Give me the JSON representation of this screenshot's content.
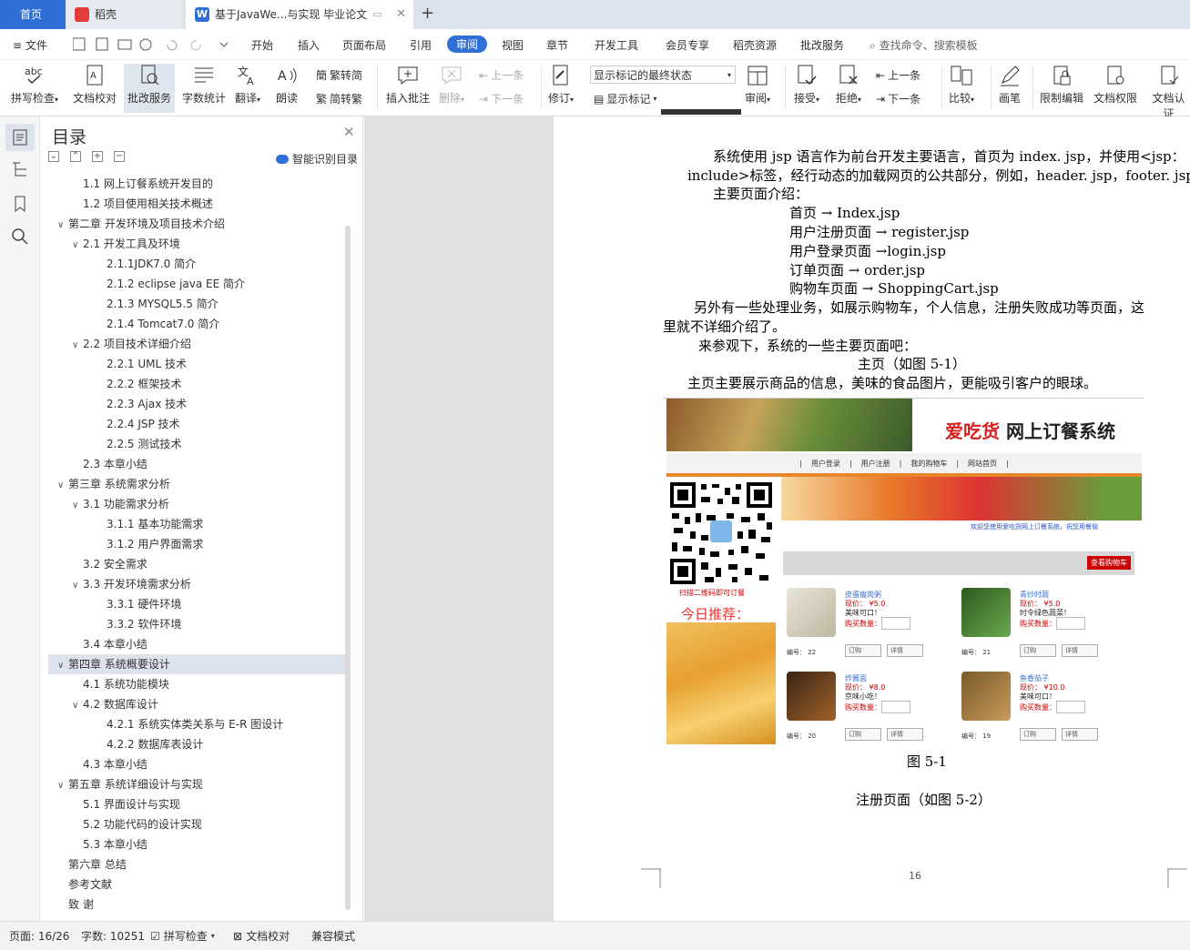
{
  "tabs": {
    "home": "首页",
    "daoke": "稻壳",
    "doc": "基于JavaWe...与实现 毕业论文"
  },
  "menu": {
    "file": "文件",
    "items": [
      "开始",
      "插入",
      "页面布局",
      "引用",
      "审阅",
      "视图",
      "章节",
      "开发工具",
      "会员专享",
      "稻壳资源",
      "批改服务"
    ],
    "active": "审阅",
    "search": "查找命令、搜索模板"
  },
  "toolbar": {
    "spell": "拼写检查",
    "proofread": "文档校对",
    "correct": "批改服务",
    "wordcount": "字数统计",
    "translate": "翻译",
    "read": "朗读",
    "to_trad": "繁转简",
    "to_simp": "简转繁",
    "insert_comment": "插入批注",
    "delete": "删除",
    "prev": "上一条",
    "next": "下一条",
    "track": "修订",
    "markup_state": "显示标记的最终状态",
    "show_markup": "显示标记",
    "review": "审阅",
    "accept": "接受",
    "reject": "拒绝",
    "prev2": "上一条",
    "next2": "下一条",
    "compare": "比较",
    "pen": "画笔",
    "restrict": "限制编辑",
    "perm": "文档权限",
    "cert": "文档认证"
  },
  "toc": {
    "title": "目录",
    "smart": "智能识别目录",
    "items": [
      {
        "label": "1.1  网上订餐系统开发目的",
        "lvl": 2,
        "car": ""
      },
      {
        "label": "1.2  项目使用相关技术概述",
        "lvl": 2,
        "car": ""
      },
      {
        "label": "第二章  开发环境及项目技术介绍",
        "lvl": 1,
        "car": "v"
      },
      {
        "label": "2.1  开发工具及环境",
        "lvl": 2,
        "car": "v"
      },
      {
        "label": "2.1.1JDK7.0 简介",
        "lvl": 3,
        "car": ""
      },
      {
        "label": "2.1.2 eclipse java EE 简介",
        "lvl": 3,
        "car": ""
      },
      {
        "label": "2.1.3 MYSQL5.5 简介",
        "lvl": 3,
        "car": ""
      },
      {
        "label": "2.1.4 Tomcat7.0 简介",
        "lvl": 3,
        "car": ""
      },
      {
        "label": "2.2  项目技术详细介绍",
        "lvl": 2,
        "car": "v"
      },
      {
        "label": "2.2.1 UML 技术",
        "lvl": 3,
        "car": ""
      },
      {
        "label": "2.2.2  框架技术",
        "lvl": 3,
        "car": ""
      },
      {
        "label": "2.2.3 Ajax 技术",
        "lvl": 3,
        "car": ""
      },
      {
        "label": "2.2.4 JSP 技术",
        "lvl": 3,
        "car": ""
      },
      {
        "label": "2.2.5  测试技术",
        "lvl": 3,
        "car": ""
      },
      {
        "label": "2.3  本章小结",
        "lvl": 2,
        "car": ""
      },
      {
        "label": "第三章  系统需求分析",
        "lvl": 1,
        "car": "v"
      },
      {
        "label": "3.1  功能需求分析",
        "lvl": 2,
        "car": "v"
      },
      {
        "label": "3.1.1  基本功能需求",
        "lvl": 3,
        "car": ""
      },
      {
        "label": "3.1.2  用户界面需求",
        "lvl": 3,
        "car": ""
      },
      {
        "label": "3.2  安全需求",
        "lvl": 2,
        "car": ""
      },
      {
        "label": "3.3 开发环境需求分析",
        "lvl": 2,
        "car": "v"
      },
      {
        "label": "3.3.1  硬件环境",
        "lvl": 3,
        "car": ""
      },
      {
        "label": "3.3.2  软件环境",
        "lvl": 3,
        "car": ""
      },
      {
        "label": "3.4  本章小结",
        "lvl": 2,
        "car": ""
      },
      {
        "label": "第四章  系统概要设计",
        "lvl": 1,
        "car": "v",
        "sel": true
      },
      {
        "label": "4.1  系统功能模块",
        "lvl": 2,
        "car": ""
      },
      {
        "label": "4.2  数据库设计",
        "lvl": 2,
        "car": "v"
      },
      {
        "label": "4.2.1  系统实体类关系与 E-R 图设计",
        "lvl": 3,
        "car": ""
      },
      {
        "label": "4.2.2  数据库表设计",
        "lvl": 3,
        "car": ""
      },
      {
        "label": "4.3  本章小结",
        "lvl": 2,
        "car": ""
      },
      {
        "label": "第五章  系统详细设计与实现",
        "lvl": 1,
        "car": "v"
      },
      {
        "label": "5.1  界面设计与实现",
        "lvl": 2,
        "car": ""
      },
      {
        "label": "5.2  功能代码的设计实现",
        "lvl": 2,
        "car": ""
      },
      {
        "label": "5.3  本章小结",
        "lvl": 2,
        "car": ""
      },
      {
        "label": "第六章  总结",
        "lvl": 1,
        "car": ""
      },
      {
        "label": "参考文献",
        "lvl": 1,
        "car": ""
      },
      {
        "label": "致  谢",
        "lvl": 1,
        "car": ""
      }
    ]
  },
  "doc": {
    "p1a": "系统使用 jsp 语言作为前台开发主要语言，首页为 index. jsp，并使用<jsp：",
    "p1b": "include>标签，经行动态的加载网页的公共部分，例如，header. jsp，footer. jsp.",
    "p2": "主要页面介绍：",
    "pages": [
      "首页  →  Index.jsp",
      "用户注册页面  →  register.jsp",
      "用户登录页面  →login.jsp",
      "订单页面  →  order.jsp",
      "购物车页面  →  ShoppingCart.jsp"
    ],
    "p3a": "另外有一些处理业务，如展示购物车，个人信息，注册失败成功等页面，这",
    "p3b": "里就不详细介绍了。",
    "p4": "来参观下，系统的一些主要页面吧：",
    "p5": "主页（如图 5-1）",
    "p6": "主页主要展示商品的信息，美味的食品图片，更能吸引客户的眼球。",
    "fig": "图 5-1",
    "p7": "注册页面（如图 5-2）",
    "page_number": "16"
  },
  "shot": {
    "title_red": "爱吃货",
    "title_black": " 网上订餐系统",
    "nav": [
      "用户登录",
      "用户注册",
      "我的购物车",
      "网站首页"
    ],
    "qr_caption": "扫描二维码即可订餐",
    "recommend": "今日推荐：",
    "welcome": "欢迎您使用爱吃货网上订餐系统，祝您用餐愉",
    "cart": "查看购物车",
    "foods": [
      {
        "name": "皮蛋瘦肉粥",
        "price": "现价： ¥5.0",
        "desc": "美味可口！",
        "qty": "购买数量：",
        "num": "编号： 22"
      },
      {
        "name": "青炒时蔬",
        "price": "现价： ¥5.0",
        "desc": "时令绿色蔬菜！",
        "qty": "购买数量：",
        "num": "编号： 21"
      },
      {
        "name": "炸酱面",
        "price": "现价： ¥8.0",
        "desc": "京味小吃！",
        "qty": "购买数量：",
        "num": "编号： 20"
      },
      {
        "name": "鱼香茄子",
        "price": "现价： ¥10.0",
        "desc": "美味可口！",
        "qty": "购买数量：",
        "num": "编号： 19"
      }
    ],
    "order_btn": "订购",
    "detail_btn": "详情"
  },
  "status": {
    "page": "页面: 16/26",
    "words": "字数: 10251",
    "spell": "拼写检查",
    "proof": "文档校对",
    "compat": "兼容模式"
  },
  "colors": {
    "accent": "#2f6fd6",
    "selected_bg": "#dde3ec"
  }
}
